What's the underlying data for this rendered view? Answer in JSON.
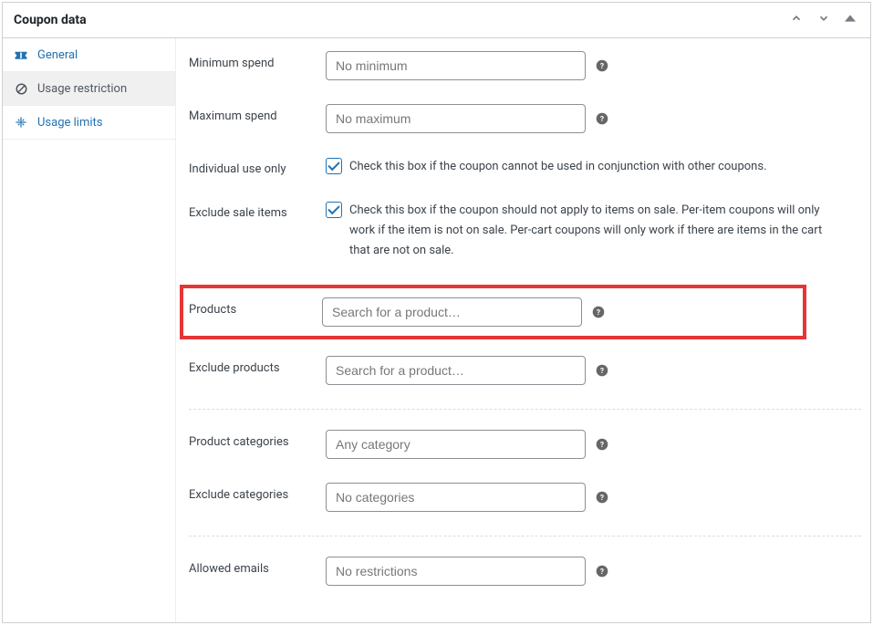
{
  "panel": {
    "title": "Coupon data"
  },
  "tabs": {
    "general": "General",
    "usage_restriction": "Usage restriction",
    "usage_limits": "Usage limits"
  },
  "fields": {
    "min_spend_label": "Minimum spend",
    "min_spend_placeholder": "No minimum",
    "max_spend_label": "Maximum spend",
    "max_spend_placeholder": "No maximum",
    "individual_use_label": "Individual use only",
    "individual_use_text": "Check this box if the coupon cannot be used in conjunction with other coupons.",
    "exclude_sale_label": "Exclude sale items",
    "exclude_sale_text": "Check this box if the coupon should not apply to items on sale. Per-item coupons will only work if the item is not on sale. Per-cart coupons will only work if there are items in the cart that are not on sale.",
    "products_label": "Products",
    "products_placeholder": "Search for a product…",
    "exclude_products_label": "Exclude products",
    "exclude_products_placeholder": "Search for a product…",
    "product_categories_label": "Product categories",
    "product_categories_placeholder": "Any category",
    "exclude_categories_label": "Exclude categories",
    "exclude_categories_placeholder": "No categories",
    "allowed_emails_label": "Allowed emails",
    "allowed_emails_placeholder": "No restrictions"
  }
}
